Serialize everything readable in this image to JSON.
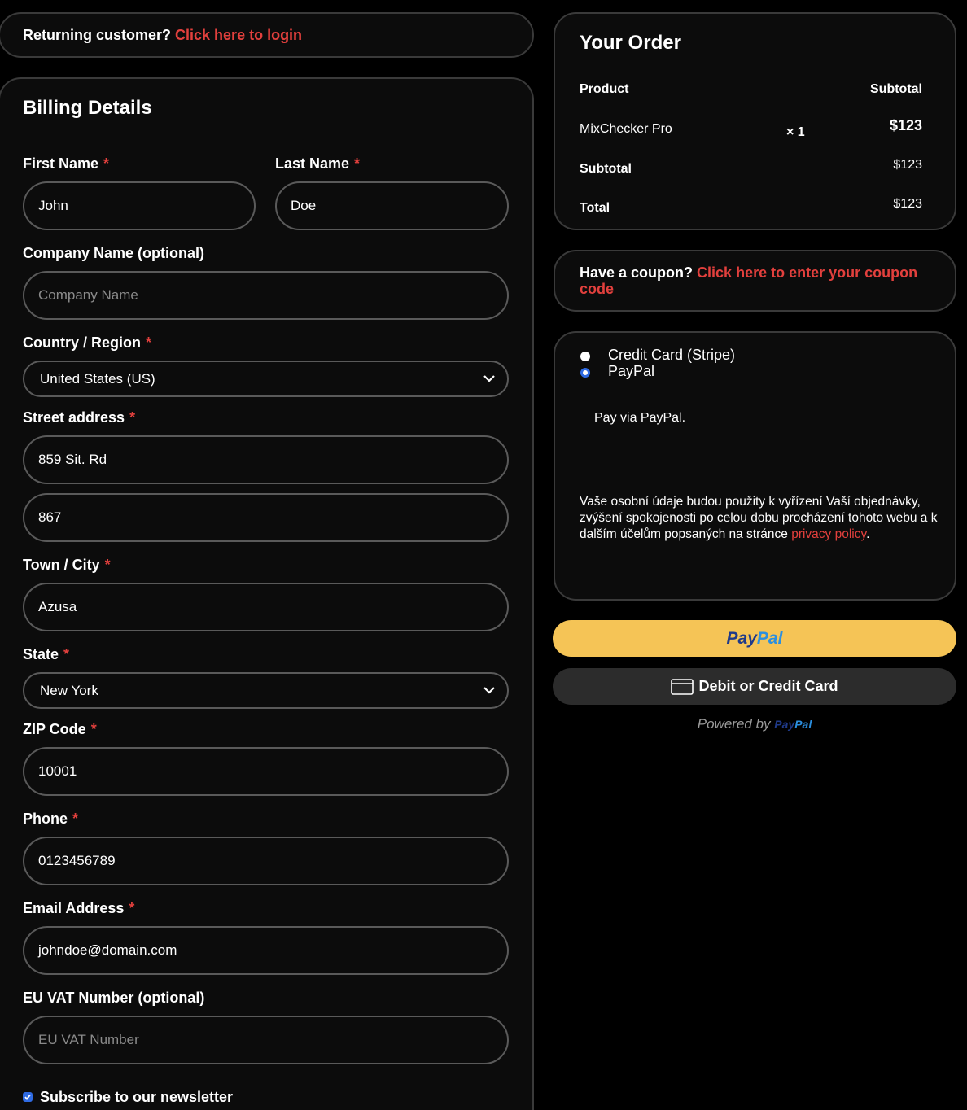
{
  "login": {
    "prompt": "Returning customer?",
    "link": "Click here to login"
  },
  "billing": {
    "title": "Billing Details",
    "first_name": {
      "label": "First Name",
      "required": "*",
      "value": "John"
    },
    "last_name": {
      "label": "Last Name",
      "required": "*",
      "value": "Doe"
    },
    "company": {
      "label": "Company Name (optional)",
      "placeholder": "Company Name"
    },
    "country": {
      "label": "Country / Region",
      "required": "*",
      "value": "United States (US)"
    },
    "street": {
      "label": "Street address",
      "required": "*",
      "line1": "859 Sit. Rd",
      "line2": "867"
    },
    "city": {
      "label": "Town / City",
      "required": "*",
      "value": "Azusa"
    },
    "state": {
      "label": "State",
      "required": "*",
      "value": "New York"
    },
    "zip": {
      "label": "ZIP Code",
      "required": "*",
      "value": "10001"
    },
    "phone": {
      "label": "Phone",
      "required": "*",
      "value": "0123456789"
    },
    "email": {
      "label": "Email Address",
      "required": "*",
      "value": "johndoe@domain.com"
    },
    "vat": {
      "label": "EU VAT Number (optional)",
      "placeholder": "EU VAT Number"
    },
    "newsletter": {
      "label": "Subscribe to our newsletter",
      "checked": true
    }
  },
  "order": {
    "title": "Your Order",
    "col_product": "Product",
    "col_subtotal": "Subtotal",
    "item_name": "MixChecker Pro",
    "item_qty": "× 1",
    "item_price": "$123",
    "subtotal_label": "Subtotal",
    "subtotal_value": "$123",
    "total_label": "Total",
    "total_value": "$123"
  },
  "coupon": {
    "prompt": "Have a coupon?",
    "link": "Click here to enter your coupon code"
  },
  "payment": {
    "option1": "Credit Card (Stripe)",
    "option2": "PayPal",
    "selected": "PayPal",
    "description": "Pay via PayPal.",
    "privacy_text": "Vaše osobní údaje budou použity k vyřízení Vaší objednávky, zvýšení spokojenosti po celou dobu procházení tohoto webu a k dalším účelům popsaných na stránce ",
    "privacy_link": "privacy policy",
    "privacy_end": "."
  },
  "paypal_buttons": {
    "paypal_pay": "Pay",
    "paypal_pal": "Pal",
    "card_label": "Debit or Credit Card",
    "powered_by": "Powered by",
    "brand_pay": "Pay",
    "brand_pal": "Pal"
  },
  "colors": {
    "accent": "#e2403d",
    "paypal_yellow": "#f5c456",
    "radio_blue": "#2f6be3"
  }
}
